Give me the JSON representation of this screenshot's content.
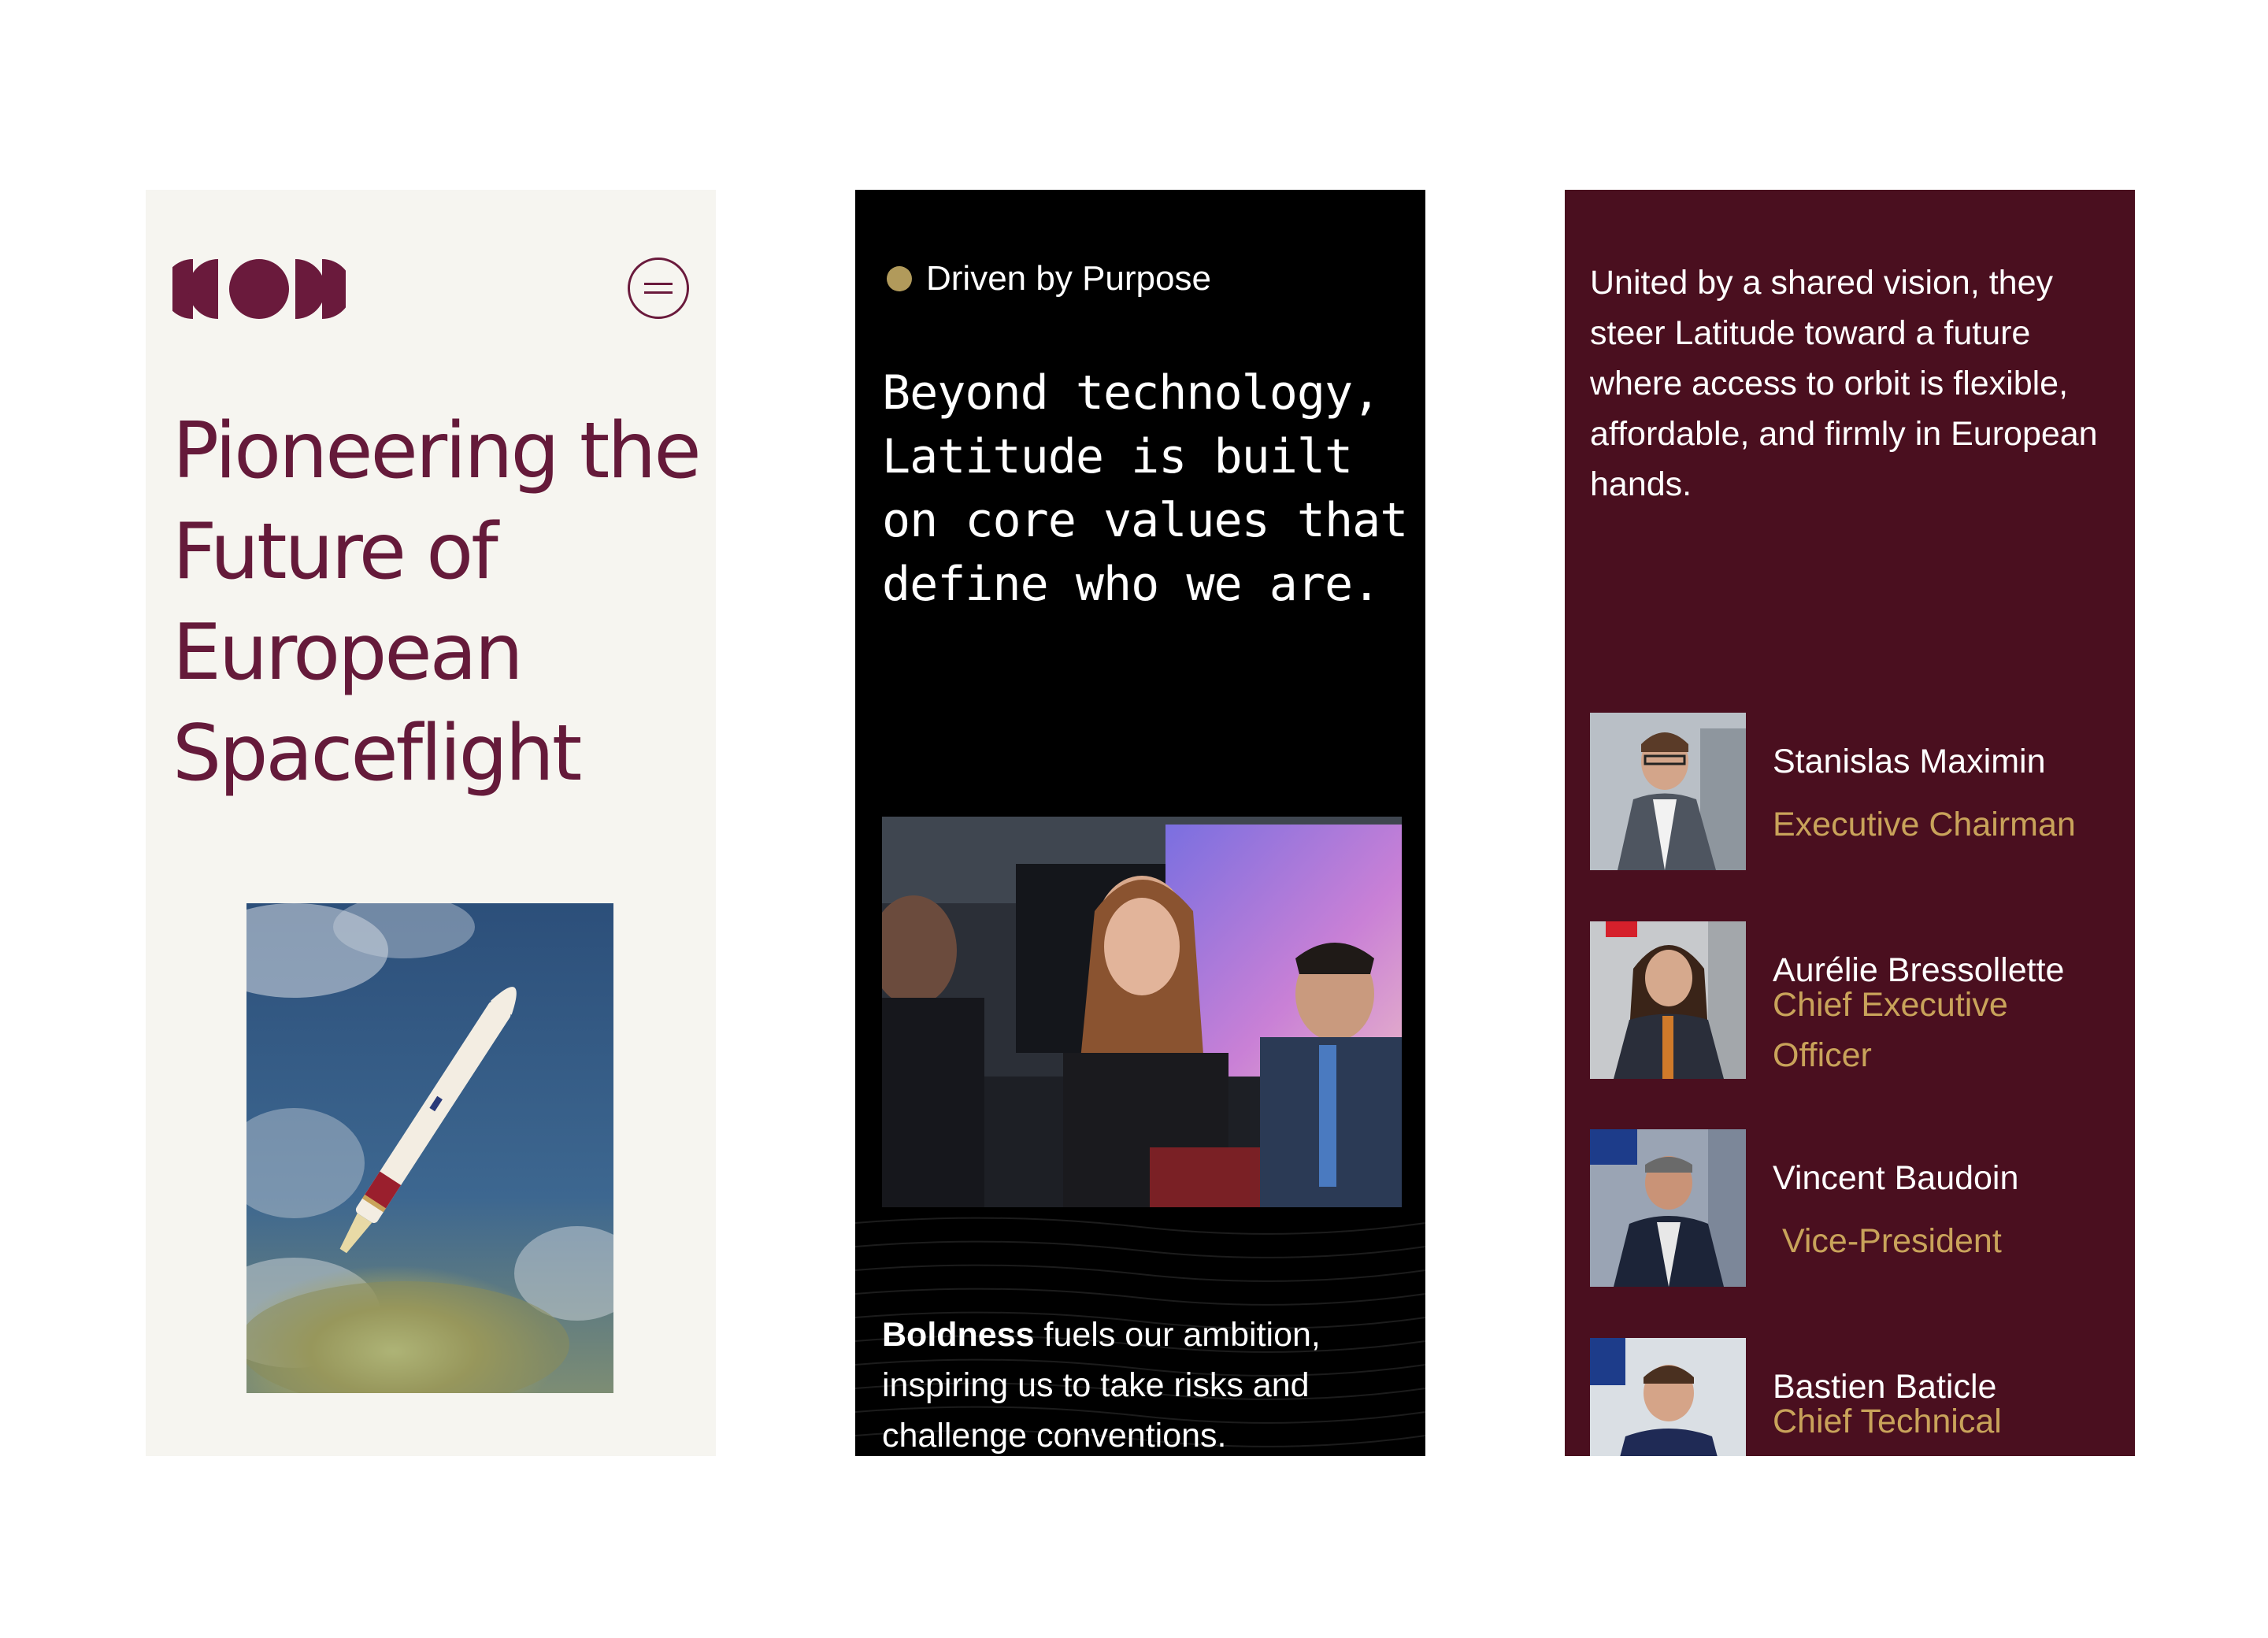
{
  "hero": {
    "title": "Pioneering the Future of European Spaceflight",
    "logo_icon": "latitude-logo-icon",
    "menu_icon": "hamburger-menu-icon"
  },
  "values": {
    "eyebrow": "Driven by Purpose",
    "heading": "Beyond technology, Latitude is built on core values that define who we are.",
    "body_bold": "Boldness",
    "body_rest": " fuels our ambition, inspiring us to take risks and challenge conventions."
  },
  "leaders": {
    "intro": "United by a shared vision, they steer Latitude toward a future where access to orbit is flexible, affordable, and firmly in European hands.",
    "people": [
      {
        "name": "Stanislas Maximin",
        "role": "Executive Chairman"
      },
      {
        "name": "Aurélie Bressollette",
        "role": "Chief Executive Officer"
      },
      {
        "name": "Vincent Baudoin",
        "role": " Vice-President"
      },
      {
        "name": "Bastien Baticle",
        "role": "Chief Technical"
      }
    ]
  },
  "colors": {
    "brand_plum": "#651a3a",
    "hero_bg": "#f6f5f0",
    "values_bg": "#000000",
    "leaders_bg": "#4a0f1f",
    "accent_gold": "#c9a35a"
  }
}
